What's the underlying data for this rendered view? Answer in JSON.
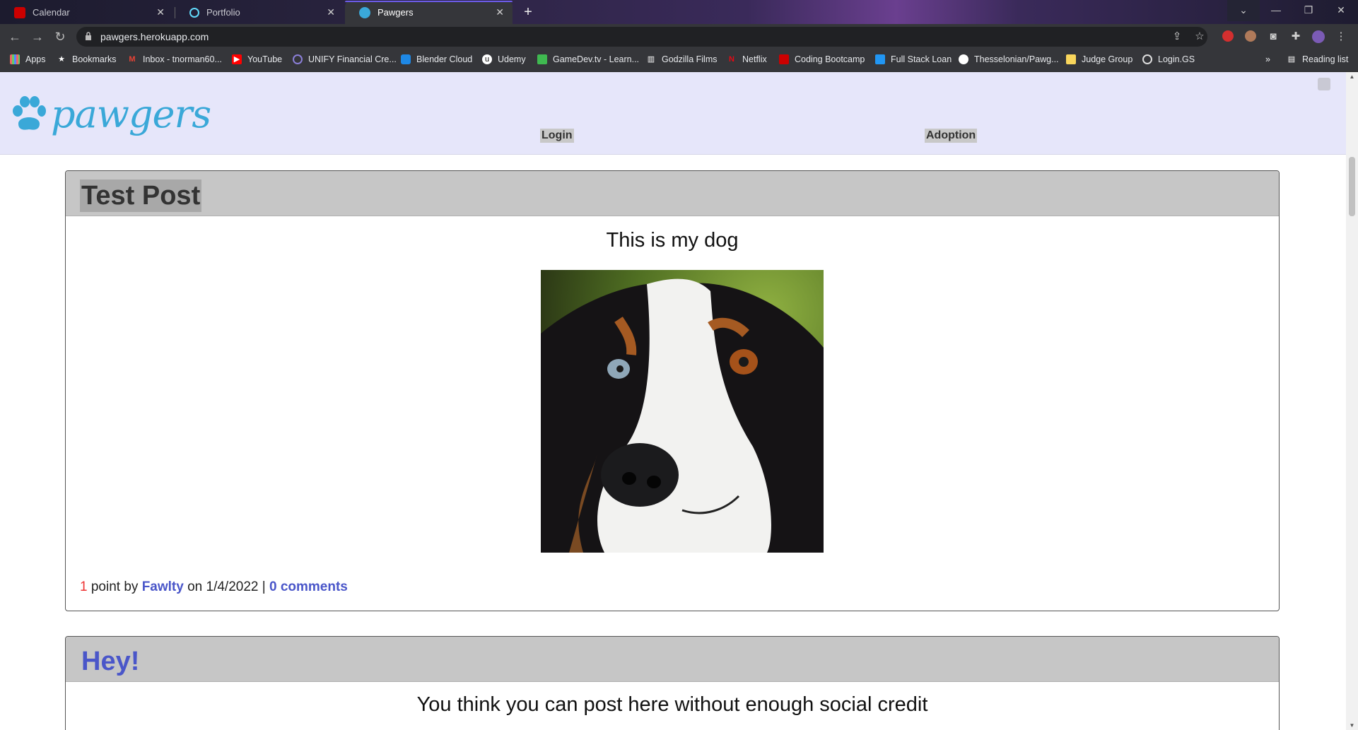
{
  "browser": {
    "tabs": [
      {
        "title": "Calendar",
        "favicon": "utah-u-icon"
      },
      {
        "title": "Portfolio",
        "favicon": "react-icon"
      },
      {
        "title": "Pawgers",
        "favicon": "paw-icon",
        "active": true
      }
    ],
    "url": "pawgers.herokuapp.com",
    "bookmarks": [
      {
        "label": "Apps",
        "icon": "apps-grid-icon"
      },
      {
        "label": "Bookmarks",
        "icon": "star-icon"
      },
      {
        "label": "Inbox - tnorman60...",
        "icon": "gmail-icon"
      },
      {
        "label": "YouTube",
        "icon": "youtube-icon"
      },
      {
        "label": "UNIFY Financial Cre...",
        "icon": "unify-icon"
      },
      {
        "label": "Blender Cloud",
        "icon": "blender-cloud-icon"
      },
      {
        "label": "Udemy",
        "icon": "udemy-icon"
      },
      {
        "label": "GameDev.tv - Learn...",
        "icon": "gamedev-icon"
      },
      {
        "label": "Godzilla Films",
        "icon": "film-icon"
      },
      {
        "label": "Netflix",
        "icon": "netflix-icon"
      },
      {
        "label": "Coding Bootcamp",
        "icon": "utah-u-icon"
      },
      {
        "label": "Full Stack Loan",
        "icon": "loan-icon"
      },
      {
        "label": "Thesselonian/Pawg...",
        "icon": "github-icon"
      },
      {
        "label": "Judge Group",
        "icon": "folder-icon"
      },
      {
        "label": "Login.GS",
        "icon": "login-gs-icon"
      }
    ],
    "overflow_label": "»",
    "reading_list": "Reading list"
  },
  "site": {
    "logo_text": "pawgers",
    "nav": {
      "login": "Login",
      "adoption": "Adoption"
    }
  },
  "posts": [
    {
      "title": "Test Post",
      "body": "This is my dog",
      "points": "1",
      "points_label": "point by",
      "author": "Fawlty",
      "date_prefix": "on",
      "date": "1/4/2022",
      "separator": "|",
      "comments": "0 comments"
    },
    {
      "title": "Hey!",
      "body": "You think you can post here without enough social credit"
    }
  ]
}
